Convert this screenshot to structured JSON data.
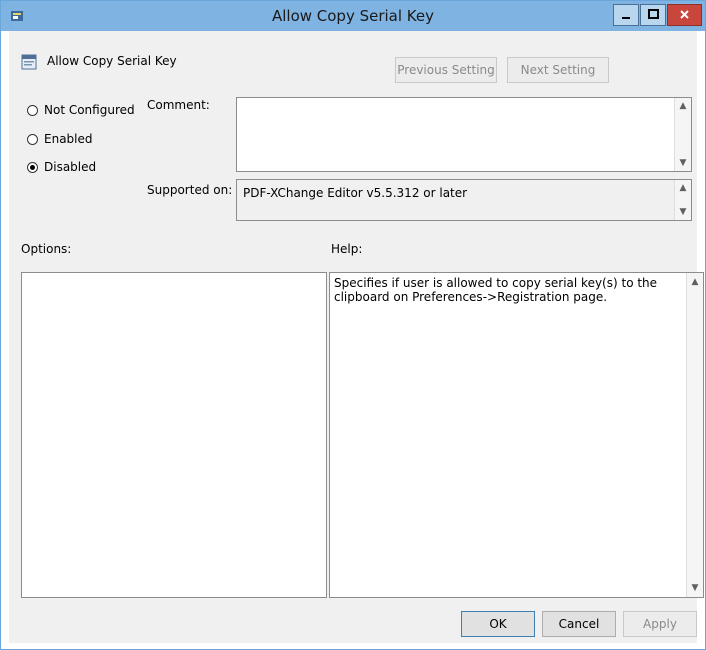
{
  "window": {
    "title": "Allow Copy Serial Key",
    "min_glyph": "–",
    "max_glyph": "□",
    "close_glyph": "x"
  },
  "header": {
    "setting_title": "Allow Copy Serial Key",
    "previous_setting": "Previous Setting",
    "next_setting": "Next Setting"
  },
  "state": {
    "options": [
      {
        "label": "Not Configured",
        "selected": false
      },
      {
        "label": "Enabled",
        "selected": false
      },
      {
        "label": "Disabled",
        "selected": true
      }
    ]
  },
  "comment": {
    "label": "Comment:",
    "value": ""
  },
  "supported": {
    "label": "Supported on:",
    "value": "PDF-XChange Editor v5.5.312 or later"
  },
  "options_label": "Options:",
  "help": {
    "label": "Help:",
    "text": "Specifies if user is allowed to copy serial key(s) to the clipboard on Preferences->Registration page."
  },
  "footer": {
    "ok": "OK",
    "cancel": "Cancel",
    "apply": "Apply"
  }
}
